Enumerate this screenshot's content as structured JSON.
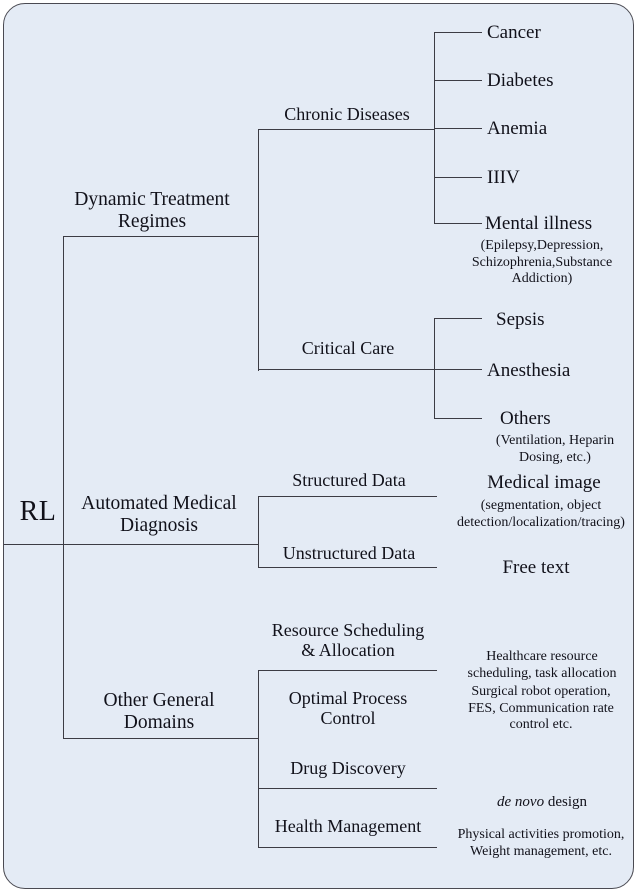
{
  "figure": {
    "root": "RL",
    "background_color": "#e4ebf5",
    "line_color": "#3c3c44",
    "border_color": "#4a4a52"
  },
  "branches": {
    "dynamic_treatment": {
      "label": "Dynamic Treatment\nRegimes",
      "children": {
        "chronic": {
          "label": "Chronic Diseases",
          "leaves": [
            {
              "label": "Cancer",
              "note": ""
            },
            {
              "label": "Diabetes",
              "note": ""
            },
            {
              "label": "Anemia",
              "note": ""
            },
            {
              "label": "IIIV",
              "note": ""
            },
            {
              "label": "Mental illness",
              "note": "(Epilepsy,Depression,\nSchizophrenia,Substance\nAddiction)"
            }
          ]
        },
        "critical": {
          "label": "Critical Care",
          "leaves": [
            {
              "label": "Sepsis",
              "note": ""
            },
            {
              "label": "Anesthesia",
              "note": ""
            },
            {
              "label": "Others",
              "note": "(Ventilation, Heparin\nDosing, etc.)"
            }
          ]
        }
      }
    },
    "automated_diagnosis": {
      "label": "Automated Medical\nDiagnosis",
      "children": [
        {
          "label": "Structured Data",
          "leaf": "Medical image",
          "note": "(segmentation, object\ndetection/localization/tracing)"
        },
        {
          "label": "Unstructured Data",
          "leaf": "Free text",
          "note": ""
        }
      ]
    },
    "other_general": {
      "label": "Other  General\nDomains",
      "children": [
        {
          "label": "Resource Scheduling\n& Allocation",
          "note": "Healthcare resource\nscheduling, task allocation",
          "note_italic_prefix": ""
        },
        {
          "label": "Optimal Process\nControl",
          "note": "Surgical robot operation,\nFES, Communication rate\ncontrol etc.",
          "note_italic_prefix": ""
        },
        {
          "label": "Drug Discovery",
          "note": " design",
          "note_italic_prefix": "de novo"
        },
        {
          "label": "Health Management",
          "note": "Physical activities promotion,\nWeight management, etc.",
          "note_italic_prefix": ""
        }
      ]
    }
  }
}
